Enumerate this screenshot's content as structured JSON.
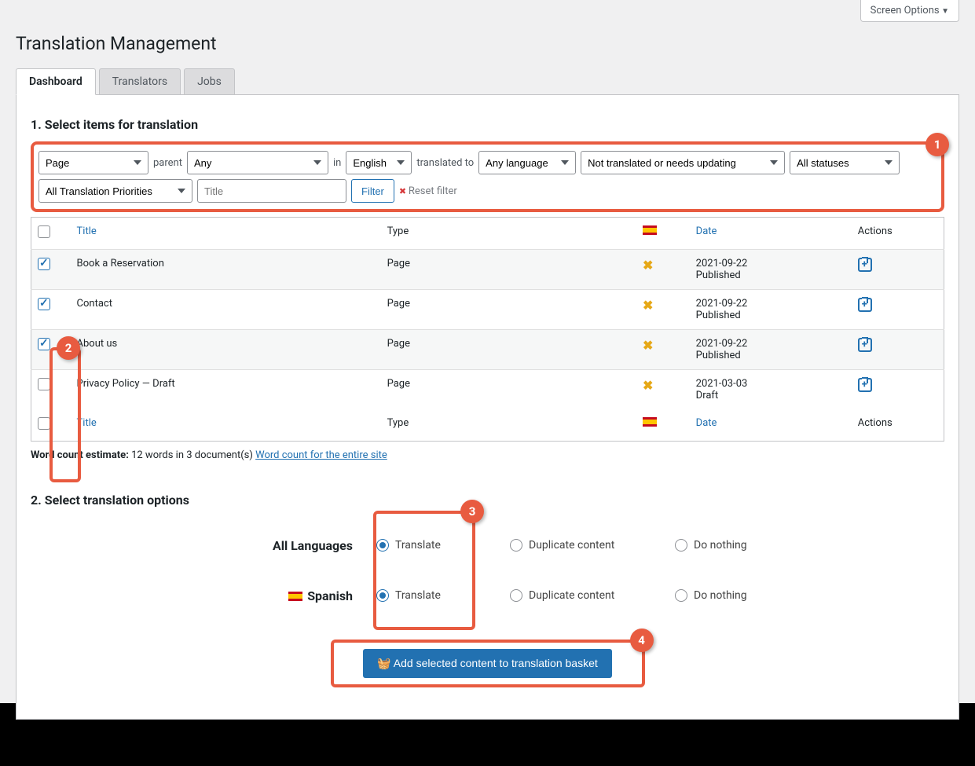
{
  "screenOptions": "Screen Options",
  "pageTitle": "Translation Management",
  "tabs": [
    "Dashboard",
    "Translators",
    "Jobs"
  ],
  "section1": "1. Select items for translation",
  "filters": {
    "pageSel": "Page",
    "parentLabel": "parent",
    "parentSel": "Any",
    "inLabel": "in",
    "langSel": "English",
    "transToLabel": "translated to",
    "anyLangSel": "Any language",
    "updSel": "Not translated or needs updating",
    "statusSel": "All statuses",
    "prioSel": "All Translation Priorities",
    "titlePlaceholder": "Title",
    "filterBtn": "Filter",
    "resetLink": "Reset filter"
  },
  "cols": {
    "title": "Title",
    "type": "Type",
    "date": "Date",
    "actions": "Actions"
  },
  "rows": [
    {
      "title": "Book a Reservation",
      "type": "Page",
      "date": "2021-09-22",
      "status": "Published",
      "checked": true
    },
    {
      "title": "Contact",
      "type": "Page",
      "date": "2021-09-22",
      "status": "Published",
      "checked": true
    },
    {
      "title": "About us",
      "type": "Page",
      "date": "2021-09-22",
      "status": "Published",
      "checked": true
    },
    {
      "title": "Privacy Policy — Draft",
      "type": "Page",
      "date": "2021-03-03",
      "status": "Draft",
      "checked": false
    }
  ],
  "wcLabel": "Word count estimate:",
  "wcText": "12 words in 3 document(s)",
  "wcLink": "Word count for the entire site",
  "section2": "2. Select translation options",
  "opts": {
    "allLang": "All Languages",
    "spanish": "Spanish",
    "translate": "Translate",
    "duplicate": "Duplicate content",
    "nothing": "Do nothing"
  },
  "basketBtn": "Add selected content to translation basket",
  "badges": {
    "b1": "1",
    "b2": "2",
    "b3": "3",
    "b4": "4"
  }
}
